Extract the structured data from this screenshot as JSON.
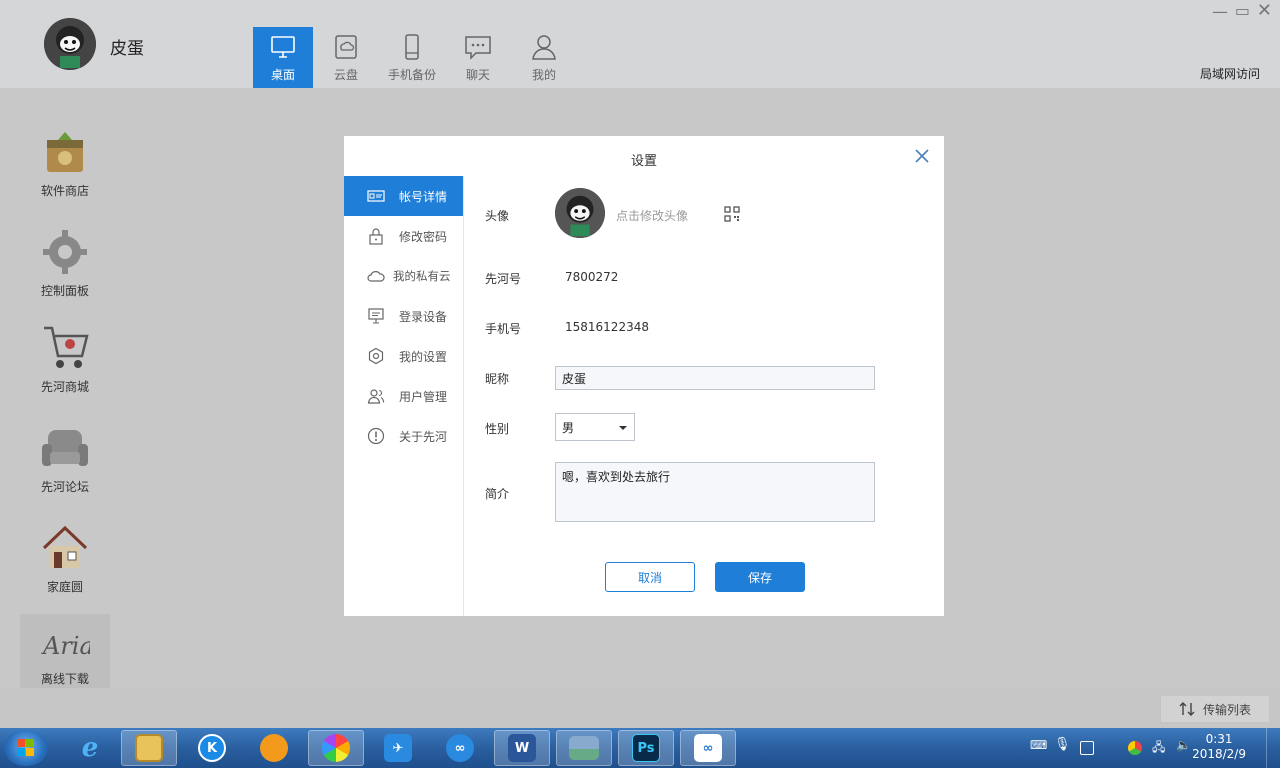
{
  "user": {
    "name": "皮蛋"
  },
  "nav": [
    {
      "label": "桌面",
      "icon": "desktop-icon",
      "active": true
    },
    {
      "label": "云盘",
      "icon": "cloud-disk-icon"
    },
    {
      "label": "手机备份",
      "icon": "phone-icon"
    },
    {
      "label": "聊天",
      "icon": "chat-icon"
    },
    {
      "label": "我的",
      "icon": "user-icon"
    }
  ],
  "lan_access": "局域网访问",
  "desktop_apps": [
    {
      "label": "软件商店",
      "icon": "software-store-icon"
    },
    {
      "label": "控制面板",
      "icon": "control-panel-icon"
    },
    {
      "label": "先河商城",
      "icon": "shopping-cart-icon"
    },
    {
      "label": "先河论坛",
      "icon": "forum-sofa-icon"
    },
    {
      "label": "家庭圆",
      "icon": "home-icon"
    },
    {
      "label": "离线下载",
      "icon": "aria-icon"
    }
  ],
  "transfer_list": "传输列表",
  "dialog": {
    "title": "设置",
    "menu": [
      {
        "label": "帐号详情",
        "icon": "id-card-icon",
        "active": true
      },
      {
        "label": "修改密码",
        "icon": "lock-icon"
      },
      {
        "label": "我的私有云",
        "icon": "cloud-icon"
      },
      {
        "label": "登录设备",
        "icon": "monitor-icon"
      },
      {
        "label": "我的设置",
        "icon": "hexagon-settings-icon"
      },
      {
        "label": "用户管理",
        "icon": "users-icon"
      },
      {
        "label": "关于先河",
        "icon": "info-icon"
      }
    ],
    "form": {
      "avatar_label": "头像",
      "avatar_hint": "点击修改头像",
      "id_label": "先河号",
      "id_value": "7800272",
      "phone_label": "手机号",
      "phone_value": "15816122348",
      "nickname_label": "昵称",
      "nickname_value": "皮蛋",
      "gender_label": "性别",
      "gender_value": "男",
      "bio_label": "简介",
      "bio_value": "嗯，喜欢到处去旅行"
    },
    "cancel_label": "取消",
    "save_label": "保存"
  },
  "taskbar": {
    "time": "0:31",
    "date": "2018/2/9",
    "apps": [
      "ie-icon",
      "file-explorer-icon",
      "kugou-icon",
      "uc-browser-icon",
      "photos-icon",
      "feige-icon",
      "baidu-netdisk-icon",
      "word-icon",
      "image-viewer-icon",
      "photoshop-icon",
      "xianhe-cloud-icon"
    ]
  }
}
